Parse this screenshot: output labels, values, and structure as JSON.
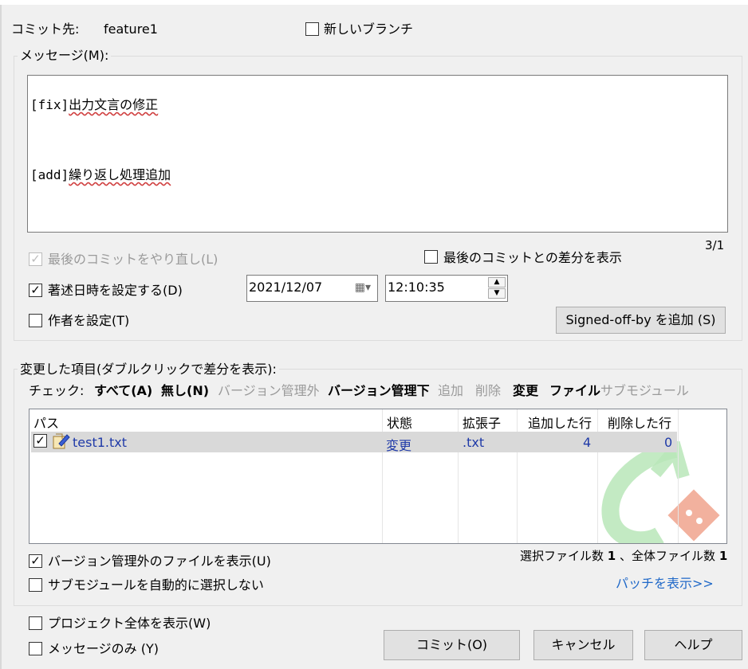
{
  "commit": {
    "target_label": "コミット先:",
    "branch": "feature1",
    "new_branch_label": "新しいブランチ"
  },
  "message": {
    "group_label": "メッセージ(M):",
    "line1_prefix": "[fix]",
    "line1_text": "出力文言の修正",
    "line2_prefix": "[add]",
    "line2_text": "繰り返し処理追加",
    "position": "3/1"
  },
  "options": {
    "amend_label": "最後のコミットをやり直し(L)",
    "show_diff_label": "最後のコミットとの差分を表示",
    "set_date_label": "著述日時を設定する(D)",
    "date_value": "2021/12/07",
    "time_value": "12:10:35",
    "set_author_label": "作者を設定(T)",
    "signoff_button": "Signed-off-by を追加 (S)"
  },
  "changes": {
    "group_label": "変更した項目(ダブルクリックで差分を表示):",
    "check_label": "チェック:",
    "filters": [
      {
        "label": "すべて(A)",
        "enabled": true
      },
      {
        "label": "無し(N)",
        "enabled": true
      },
      {
        "label": "バージョン管理外",
        "enabled": false
      },
      {
        "label": "バージョン管理下",
        "enabled": true
      },
      {
        "label": "追加",
        "enabled": false
      },
      {
        "label": "削除",
        "enabled": false
      },
      {
        "label": "変更",
        "enabled": true
      },
      {
        "label": "ファイル",
        "enabled": true
      },
      {
        "label": "サブモジュール",
        "enabled": false
      }
    ],
    "columns": [
      "パス",
      "状態",
      "拡張子",
      "追加した行",
      "削除した行"
    ],
    "rows": [
      {
        "path": "test1.txt",
        "status": "変更",
        "ext": ".txt",
        "added": "4",
        "deleted": "0",
        "checked": true
      }
    ],
    "show_unversioned_label": "バージョン管理外のファイルを表示(U)",
    "no_auto_submodule_label": "サブモジュールを自動的に選択しない",
    "selected_label": "選択ファイル数",
    "selected_count": "1",
    "total_label": "、全体ファイル数",
    "total_count": "1",
    "show_patch_link": "パッチを表示>>"
  },
  "footer": {
    "show_project_label": "プロジェクト全体を表示(W)",
    "message_only_label": "メッセージのみ (Y)",
    "commit_button": "コミット(O)",
    "cancel_button": "キャンセル",
    "help_button": "ヘルプ"
  },
  "colors": {
    "background": "#f0f0f0",
    "link": "#1f68c8",
    "list_text": "#1f3aa8",
    "logo_green": "#5cc55c",
    "logo_red": "#e24329"
  }
}
